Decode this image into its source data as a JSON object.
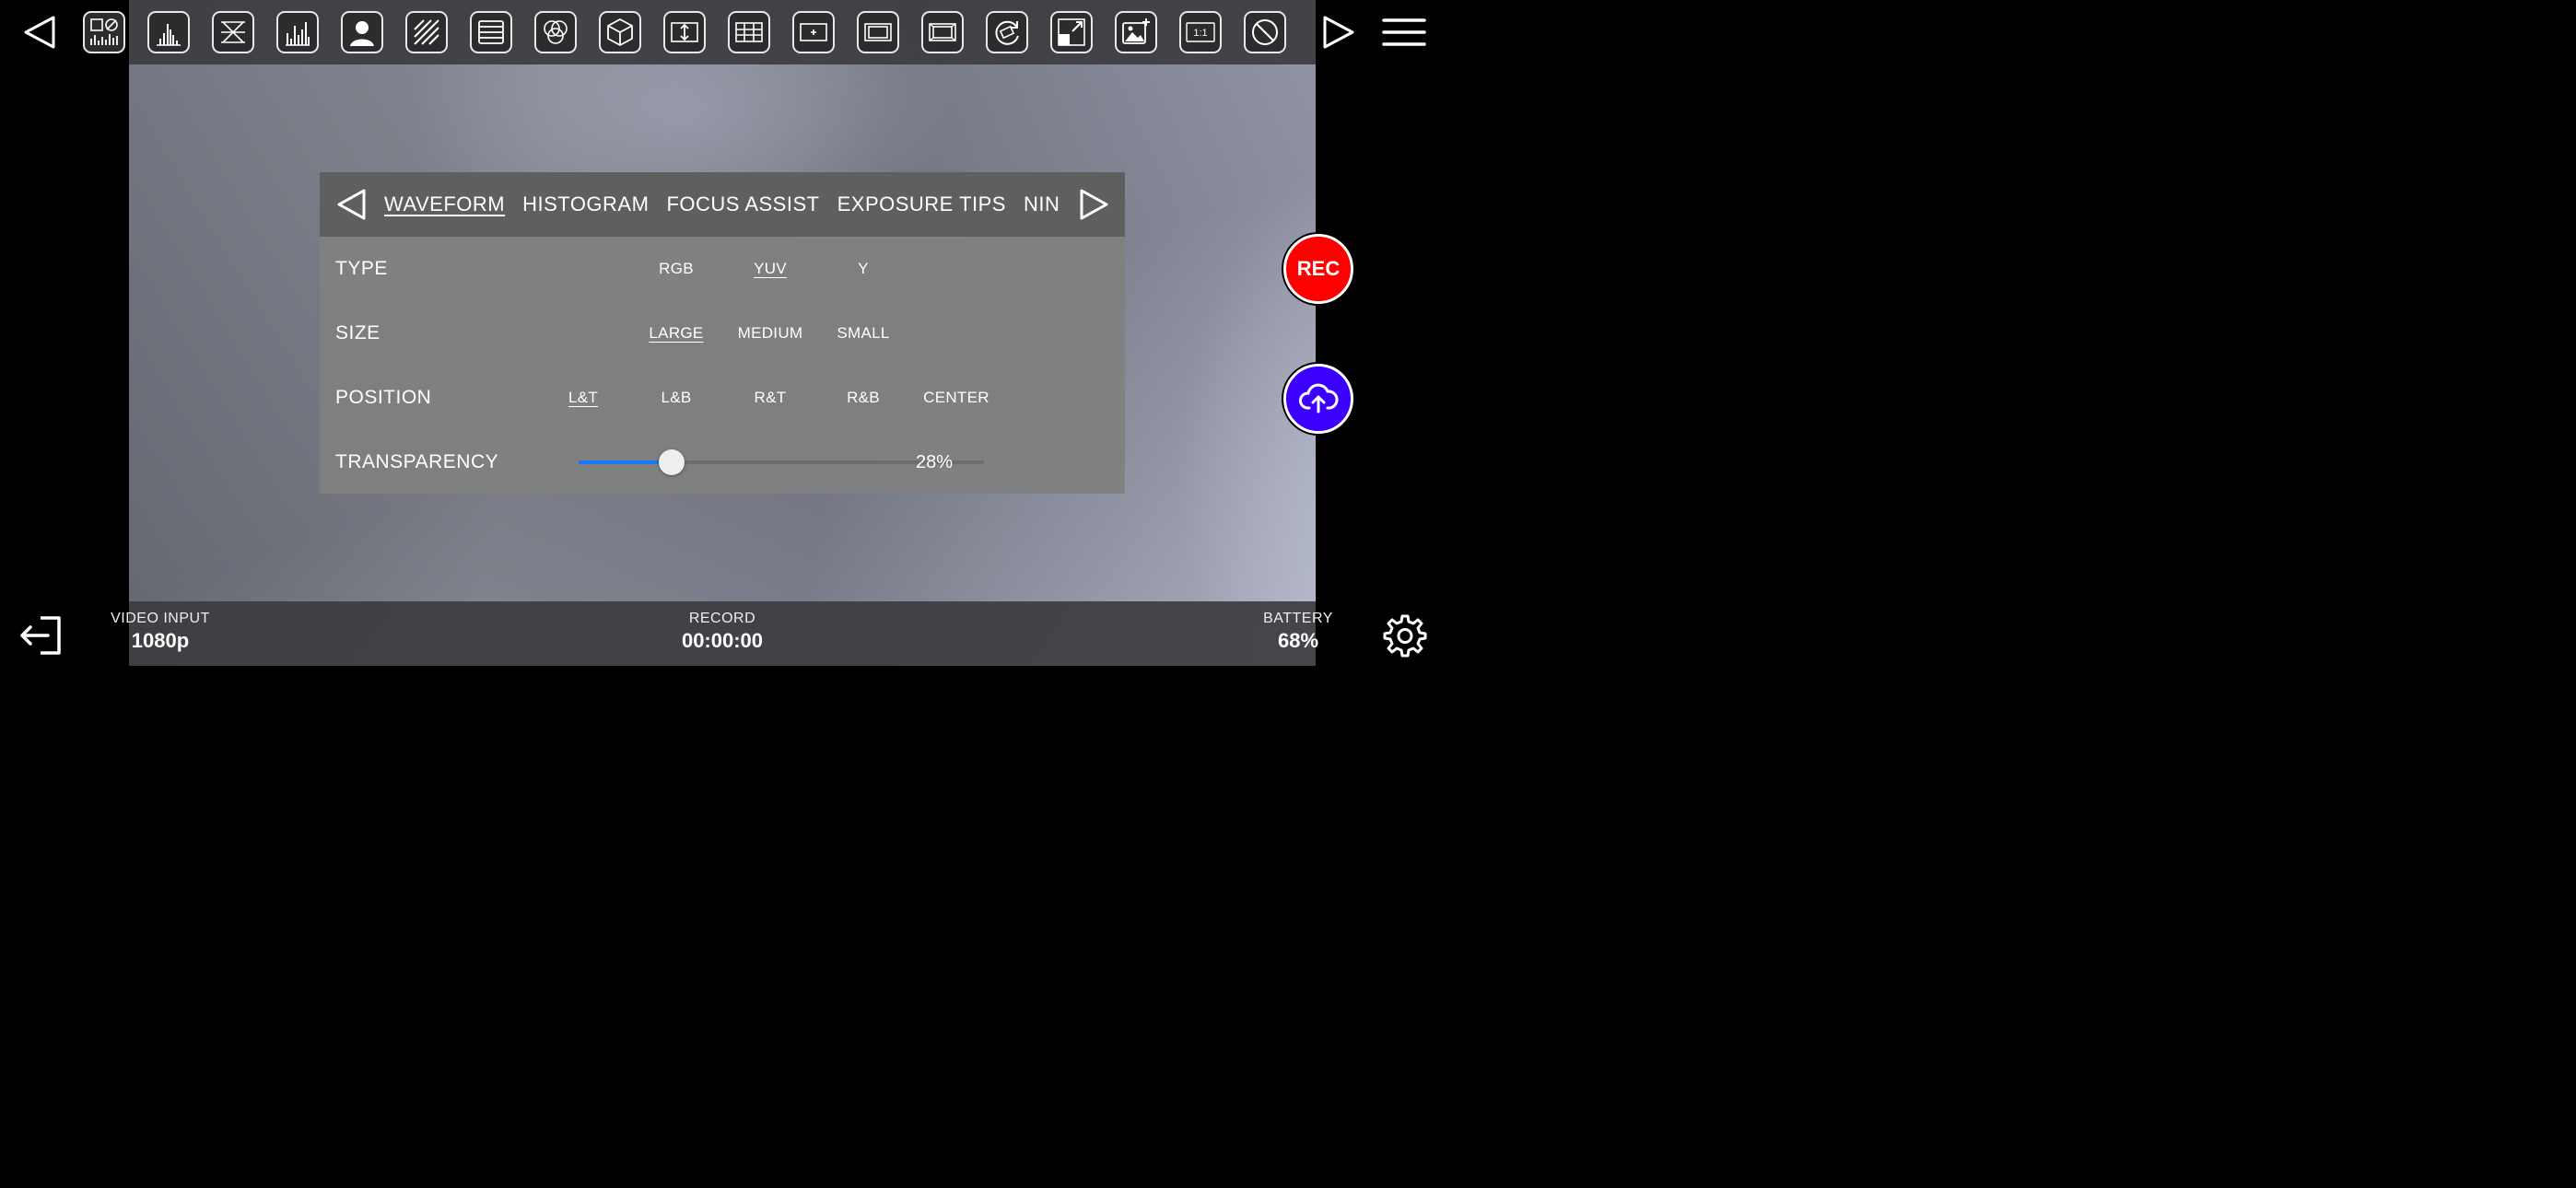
{
  "panel": {
    "tabs": [
      "WAVEFORM",
      "HISTOGRAM",
      "FOCUS ASSIST",
      "EXPOSURE TIPS",
      "NINE GRID"
    ],
    "active_tab": "WAVEFORM",
    "rows": {
      "type": {
        "label": "TYPE",
        "options": [
          "RGB",
          "YUV",
          "Y"
        ],
        "selected": "YUV"
      },
      "size": {
        "label": "SIZE",
        "options": [
          "LARGE",
          "MEDIUM",
          "SMALL"
        ],
        "selected": "LARGE"
      },
      "position": {
        "label": "POSITION",
        "options": [
          "L&T",
          "L&B",
          "R&T",
          "R&B",
          "CENTER"
        ],
        "selected": "L&T"
      },
      "transparency": {
        "label": "TRANSPARENCY",
        "value_text": "28%",
        "value": 0.28
      }
    }
  },
  "rec_label": "REC",
  "status": {
    "video_input_label": "VIDEO INPUT",
    "video_input_value": "1080p",
    "record_label": "RECORD",
    "record_value": "00:00:00",
    "battery_label": "BATTERY",
    "battery_value": "68%"
  },
  "toolbar_icons": [
    "multiview-icon",
    "false-color-icon",
    "zebra-icon",
    "histogram-icon",
    "portrait-icon",
    "stripes-icon",
    "lines-icon",
    "color-circles-icon",
    "cube-icon",
    "vertical-stretch-icon",
    "grid-icon",
    "center-marker-icon",
    "frame-guide-icon",
    "safe-area-icon",
    "rotate-icon",
    "scale-icon",
    "image-add-icon",
    "one-to-one-icon",
    "disable-icon"
  ],
  "toolbar_one_to_one_label": "1:1",
  "colors": {
    "rec": "#ff0000",
    "upload": "#3b00ff",
    "slider": "#1677ff"
  }
}
